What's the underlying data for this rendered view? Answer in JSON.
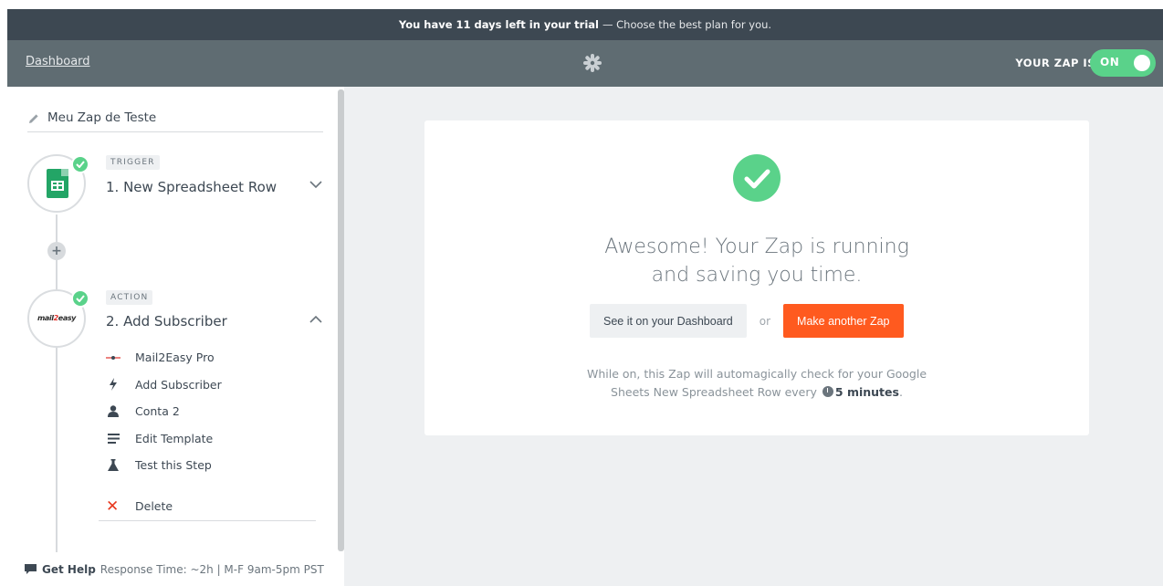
{
  "trial_bar": {
    "message_strong": "You have 11 days left in your trial",
    "message_light": "— Choose the best plan for you."
  },
  "topbar": {
    "dashboard_link": "Dashboard",
    "zap_status_label": "YOUR ZAP IS",
    "toggle_label": "ON",
    "toggle_state": "on",
    "logo_icon": "zapier-asterisk-icon"
  },
  "sidebar": {
    "zap_name": "Meu Zap de Teste",
    "steps": [
      {
        "tag": "TRIGGER",
        "title": "1. New Spreadsheet Row",
        "app_icon": "google-sheets-icon",
        "expanded": false
      },
      {
        "tag": "ACTION",
        "title": "2. Add Subscriber",
        "app_icon": "mail2easy-logo",
        "logo_text_a": "mail",
        "logo_text_b": "2",
        "logo_text_c": "easy",
        "expanded": true,
        "sub_items": [
          {
            "label": "Mail2Easy Pro",
            "icon": "app-logo-icon"
          },
          {
            "label": "Add Subscriber",
            "icon": "lightning-icon"
          },
          {
            "label": "Conta 2",
            "icon": "user-icon"
          },
          {
            "label": "Edit Template",
            "icon": "list-icon"
          },
          {
            "label": "Test this Step",
            "icon": "flask-icon"
          }
        ],
        "delete_label": "Delete"
      }
    ],
    "help": {
      "label": "Get Help",
      "meta": "Response Time: ~2h | M-F 9am-5pm PST"
    }
  },
  "main": {
    "success_title": "Awesome! Your Zap is running and saving you time.",
    "dashboard_button": "See it on your Dashboard",
    "or_text": "or",
    "make_button": "Make another Zap",
    "info_pre": "While on, this Zap will automagically check for your Google Sheets New Spreadsheet Row every",
    "info_interval": "5 minutes",
    "info_post": "."
  },
  "colors": {
    "accent_green": "#5ad28a",
    "accent_orange": "#ff5a1f",
    "topbar": "#5f6c72",
    "trial_bar": "#3d4852"
  }
}
